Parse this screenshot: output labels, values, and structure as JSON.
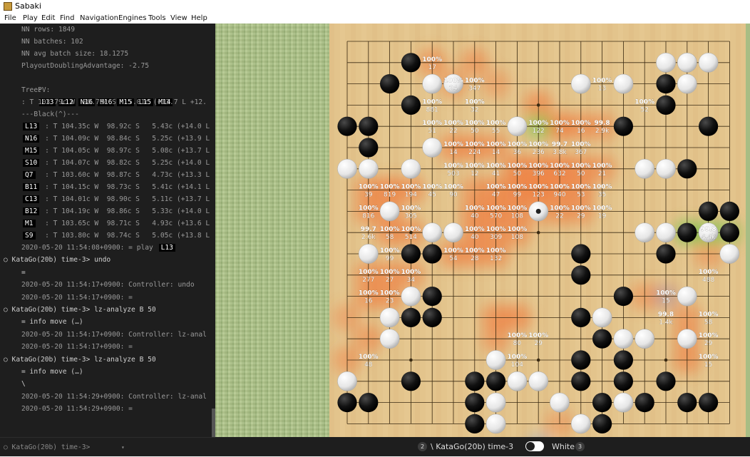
{
  "window": {
    "title": "Sabaki"
  },
  "menu": [
    "File",
    "Play",
    "Edit",
    "Find",
    "Navigation",
    "Engines",
    "Tools",
    "View",
    "Help"
  ],
  "console": {
    "stats": [
      "NN rows: 1849",
      "NN batches: 102",
      "NN avg batch size: 18.1275",
      "PlayoutDoublingAdvantage: -2.75"
    ],
    "pv_label": "PV:",
    "pv_moves": [
      "L13",
      "L12",
      "N16",
      "M16",
      "M15",
      "L15",
      "M14"
    ],
    "tree_label": "Tree:",
    "tree_root": ": T 103.79c W  98.78c S   5.01c (+13.7 L +12.",
    "black_header": "---Black(^)---",
    "tree_rows": [
      {
        "move": "L13",
        "text": " : T 104.35c W  98.92c S   5.43c (+14.0 L"
      },
      {
        "move": "N16",
        "text": " : T 104.09c W  98.84c S   5.25c (+13.9 L"
      },
      {
        "move": "M15",
        "text": " : T 104.05c W  98.97c S   5.08c (+13.7 L"
      },
      {
        "move": "S10",
        "text": " : T 104.07c W  98.82c S   5.25c (+14.0 L"
      },
      {
        "move": "Q7",
        "text": "  : T 103.60c W  98.87c S   4.73c (+13.3 L"
      },
      {
        "move": "B11",
        "text": " : T 104.15c W  98.73c S   5.41c (+14.1 L"
      },
      {
        "move": "C13",
        "text": " : T 104.01c W  98.90c S   5.11c (+13.7 L"
      },
      {
        "move": "B12",
        "text": " : T 104.19c W  98.86c S   5.33c (+14.0 L"
      },
      {
        "move": "M1",
        "text": "  : T 103.65c W  98.71c S   4.93c (+13.6 L"
      },
      {
        "move": "S9",
        "text": "  : T 103.80c W  98.74c S   5.05c (+13.8 L"
      }
    ],
    "log": [
      {
        "kind": "ts",
        "text": "2020-05-20 11:54:08+0900: = play ",
        "move": "L13"
      },
      {
        "kind": "prompt",
        "text": "○ KataGo(20b) time-3> undo"
      },
      {
        "kind": "resp",
        "text": "="
      },
      {
        "kind": "ts",
        "text": "2020-05-20 11:54:17+0900: Controller: undo"
      },
      {
        "kind": "ts",
        "text": "2020-05-20 11:54:17+0900: ="
      },
      {
        "kind": "prompt",
        "text": "○ KataGo(20b) time-3> lz-analyze B 50"
      },
      {
        "kind": "resp",
        "text": "= info move (…)"
      },
      {
        "kind": "ts",
        "text": "2020-05-20 11:54:17+0900: Controller: lz-anal"
      },
      {
        "kind": "ts",
        "text": "2020-05-20 11:54:17+0900: ="
      },
      {
        "kind": "prompt",
        "text": "○ KataGo(20b) time-3> lz-analyze B 50"
      },
      {
        "kind": "resp",
        "text": "= info move (…)"
      },
      {
        "kind": "resp",
        "text": "\\"
      },
      {
        "kind": "ts",
        "text": "2020-05-20 11:54:29+0900: Controller: lz-anal"
      },
      {
        "kind": "ts",
        "text": "2020-05-20 11:54:29+0900: ="
      }
    ]
  },
  "input": {
    "prompt": "○ KataGo(20b) time-3>",
    "caret": "▾"
  },
  "board": {
    "size": 19,
    "black": [
      [
        3,
        1
      ],
      [
        2,
        2
      ],
      [
        3,
        3
      ],
      [
        0,
        4
      ],
      [
        1,
        4
      ],
      [
        1,
        5
      ],
      [
        13,
        4
      ],
      [
        15,
        2
      ],
      [
        15,
        3
      ],
      [
        16,
        1
      ],
      [
        17,
        4
      ],
      [
        16,
        6
      ],
      [
        17,
        8
      ],
      [
        18,
        8
      ],
      [
        18,
        9
      ],
      [
        16,
        9
      ],
      [
        15,
        10
      ],
      [
        11,
        10
      ],
      [
        4,
        10
      ],
      [
        3,
        10
      ],
      [
        11,
        11
      ],
      [
        13,
        12
      ],
      [
        4,
        12
      ],
      [
        3,
        13
      ],
      [
        4,
        13
      ],
      [
        11,
        13
      ],
      [
        12,
        14
      ],
      [
        14,
        14
      ],
      [
        11,
        15
      ],
      [
        13,
        15
      ],
      [
        3,
        16
      ],
      [
        6,
        16
      ],
      [
        7,
        16
      ],
      [
        8,
        16
      ],
      [
        11,
        16
      ],
      [
        13,
        16
      ],
      [
        15,
        16
      ],
      [
        0,
        17
      ],
      [
        1,
        17
      ],
      [
        6,
        17
      ],
      [
        12,
        17
      ],
      [
        14,
        17
      ],
      [
        16,
        17
      ],
      [
        17,
        17
      ],
      [
        6,
        18
      ],
      [
        12,
        18
      ]
    ],
    "white": [
      [
        15,
        1
      ],
      [
        16,
        1
      ],
      [
        17,
        1
      ],
      [
        4,
        2
      ],
      [
        5,
        2
      ],
      [
        11,
        2
      ],
      [
        13,
        2
      ],
      [
        16,
        2
      ],
      [
        8,
        4
      ],
      [
        4,
        5
      ],
      [
        1,
        6
      ],
      [
        0,
        6
      ],
      [
        3,
        6
      ],
      [
        14,
        6
      ],
      [
        15,
        6
      ],
      [
        2,
        8
      ],
      [
        4,
        9
      ],
      [
        5,
        9
      ],
      [
        14,
        9
      ],
      [
        15,
        9
      ],
      [
        17,
        9
      ],
      [
        1,
        10
      ],
      [
        18,
        10
      ],
      [
        3,
        12
      ],
      [
        16,
        12
      ],
      [
        2,
        13
      ],
      [
        12,
        13
      ],
      [
        2,
        14
      ],
      [
        13,
        14
      ],
      [
        14,
        14
      ],
      [
        16,
        14
      ],
      [
        7,
        15
      ],
      [
        0,
        16
      ],
      [
        8,
        16
      ],
      [
        9,
        16
      ],
      [
        7,
        17
      ],
      [
        10,
        17
      ],
      [
        13,
        17
      ],
      [
        7,
        18
      ],
      [
        11,
        18
      ],
      [
        8,
        19
      ],
      [
        11,
        19
      ]
    ],
    "last_move": [
      9,
      8
    ],
    "heat": [
      [
        4,
        1,
        0.55
      ],
      [
        5,
        2,
        0.45
      ],
      [
        6,
        1,
        0.5
      ],
      [
        7,
        2,
        0.4
      ],
      [
        9,
        3,
        0.6
      ],
      [
        10,
        4,
        0.7
      ],
      [
        11,
        4,
        0.55
      ],
      [
        12,
        4,
        0.5
      ],
      [
        5,
        5,
        0.6
      ],
      [
        6,
        5,
        0.6
      ],
      [
        7,
        5,
        0.5
      ],
      [
        8,
        6,
        0.7
      ],
      [
        9,
        6,
        0.7
      ],
      [
        10,
        6,
        0.75
      ],
      [
        11,
        6,
        0.6
      ],
      [
        12,
        6,
        0.5
      ],
      [
        1,
        7,
        0.55
      ],
      [
        2,
        7,
        0.65
      ],
      [
        3,
        7,
        0.55
      ],
      [
        6,
        7,
        0.5
      ],
      [
        7,
        7,
        0.6
      ],
      [
        8,
        7,
        0.7
      ],
      [
        9,
        7,
        0.8
      ],
      [
        10,
        7,
        0.65
      ],
      [
        11,
        7,
        0.6
      ],
      [
        1,
        8,
        0.55
      ],
      [
        2,
        8,
        0.5
      ],
      [
        6,
        8,
        0.6
      ],
      [
        7,
        8,
        0.65
      ],
      [
        8,
        8,
        0.6
      ],
      [
        9,
        8,
        0.4
      ],
      [
        10,
        8,
        0.55
      ],
      [
        11,
        8,
        0.5
      ],
      [
        2,
        9,
        0.6
      ],
      [
        3,
        9,
        0.55
      ],
      [
        6,
        9,
        0.6
      ],
      [
        7,
        9,
        0.55
      ],
      [
        8,
        9,
        0.55
      ],
      [
        5,
        10,
        0.6
      ],
      [
        6,
        10,
        0.6
      ],
      [
        7,
        10,
        0.55
      ],
      [
        1,
        11,
        0.55
      ],
      [
        2,
        11,
        0.55
      ],
      [
        3,
        11,
        0.5
      ],
      [
        1,
        12,
        0.55
      ],
      [
        2,
        12,
        0.55
      ],
      [
        7,
        13,
        0.6
      ],
      [
        8,
        13,
        0.6
      ],
      [
        7,
        14,
        0.5
      ],
      [
        1,
        14,
        0.5
      ],
      [
        14,
        12,
        0.45
      ],
      [
        16,
        13,
        0.5
      ],
      [
        16,
        14,
        0.5
      ],
      [
        16,
        15,
        0.55
      ],
      [
        17,
        10,
        0.45
      ],
      [
        10,
        18,
        0.4
      ],
      [
        0,
        13,
        0.4
      ],
      [
        0,
        15,
        0.45
      ],
      [
        15,
        12,
        0.35
      ]
    ],
    "heat_green": [
      [
        9,
        4,
        0.6
      ],
      [
        16,
        9,
        0.7
      ],
      [
        17,
        9,
        0.7
      ],
      [
        18,
        9,
        0.55
      ]
    ],
    "heat_blue": [
      [
        9,
        19,
        0.4
      ],
      [
        15,
        12,
        0.35
      ]
    ],
    "labels": [
      {
        "c": 4,
        "r": 1,
        "a": "100%",
        "b": "17"
      },
      {
        "c": 5,
        "r": 2,
        "a": "100%",
        "b": "24"
      },
      {
        "c": 6,
        "r": 2,
        "a": "100%",
        "b": "347"
      },
      {
        "c": 12,
        "r": 2,
        "a": "100%",
        "b": "13"
      },
      {
        "c": 4,
        "r": 3,
        "a": "100%",
        "b": "881"
      },
      {
        "c": 6,
        "r": 3,
        "a": "100%",
        "b": "32"
      },
      {
        "c": 14,
        "r": 3,
        "a": "100%",
        "b": "52"
      },
      {
        "c": 4,
        "r": 4,
        "a": "100%",
        "b": "51"
      },
      {
        "c": 5,
        "r": 4,
        "a": "100%",
        "b": "22"
      },
      {
        "c": 6,
        "r": 4,
        "a": "100%",
        "b": "50"
      },
      {
        "c": 7,
        "r": 4,
        "a": "100%",
        "b": "55"
      },
      {
        "c": 9,
        "r": 4,
        "a": "100%",
        "b": "122"
      },
      {
        "c": 10,
        "r": 4,
        "a": "100%",
        "b": "74"
      },
      {
        "c": 11,
        "r": 4,
        "a": "100%",
        "b": "16"
      },
      {
        "c": 12,
        "r": 4,
        "a": "99.8",
        "b": "2.9k"
      },
      {
        "c": 5,
        "r": 5,
        "a": "100%",
        "b": "14"
      },
      {
        "c": 6,
        "r": 5,
        "a": "100%",
        "b": "224"
      },
      {
        "c": 7,
        "r": 5,
        "a": "100%",
        "b": "14"
      },
      {
        "c": 8,
        "r": 5,
        "a": "100%",
        "b": "36"
      },
      {
        "c": 9,
        "r": 5,
        "a": "100%",
        "b": "236"
      },
      {
        "c": 10,
        "r": 5,
        "a": "99.7",
        "b": "3.8k"
      },
      {
        "c": 11,
        "r": 5,
        "a": "100%",
        "b": "367"
      },
      {
        "c": 5,
        "r": 6,
        "a": "100%",
        "b": "503"
      },
      {
        "c": 6,
        "r": 6,
        "a": "100%",
        "b": "12"
      },
      {
        "c": 7,
        "r": 6,
        "a": "100%",
        "b": "41"
      },
      {
        "c": 8,
        "r": 6,
        "a": "100%",
        "b": "50"
      },
      {
        "c": 9,
        "r": 6,
        "a": "100%",
        "b": "396"
      },
      {
        "c": 10,
        "r": 6,
        "a": "100%",
        "b": "632"
      },
      {
        "c": 11,
        "r": 6,
        "a": "100%",
        "b": "50"
      },
      {
        "c": 12,
        "r": 6,
        "a": "100%",
        "b": "21"
      },
      {
        "c": 1,
        "r": 7,
        "a": "100%",
        "b": "39"
      },
      {
        "c": 2,
        "r": 7,
        "a": "100%",
        "b": "819"
      },
      {
        "c": 3,
        "r": 7,
        "a": "100%",
        "b": "194"
      },
      {
        "c": 4,
        "r": 7,
        "a": "100%",
        "b": "45"
      },
      {
        "c": 5,
        "r": 7,
        "a": "100%",
        "b": "90"
      },
      {
        "c": 7,
        "r": 7,
        "a": "100%",
        "b": "47"
      },
      {
        "c": 8,
        "r": 7,
        "a": "100%",
        "b": "99"
      },
      {
        "c": 9,
        "r": 7,
        "a": "100%",
        "b": "123"
      },
      {
        "c": 10,
        "r": 7,
        "a": "100%",
        "b": "940"
      },
      {
        "c": 11,
        "r": 7,
        "a": "100%",
        "b": "53"
      },
      {
        "c": 12,
        "r": 7,
        "a": "100%",
        "b": "35"
      },
      {
        "c": 1,
        "r": 8,
        "a": "100%",
        "b": "816"
      },
      {
        "c": 3,
        "r": 8,
        "a": "100%",
        "b": "305"
      },
      {
        "c": 6,
        "r": 8,
        "a": "100%",
        "b": "40"
      },
      {
        "c": 7,
        "r": 8,
        "a": "100%",
        "b": "570"
      },
      {
        "c": 8,
        "r": 8,
        "a": "100%",
        "b": "108"
      },
      {
        "c": 10,
        "r": 8,
        "a": "100%",
        "b": "22"
      },
      {
        "c": 11,
        "r": 8,
        "a": "100%",
        "b": "29"
      },
      {
        "c": 12,
        "r": 8,
        "a": "100%",
        "b": "19"
      },
      {
        "c": 1,
        "r": 9,
        "a": "99.7",
        "b": "2.6k"
      },
      {
        "c": 2,
        "r": 9,
        "a": "100%",
        "b": "58"
      },
      {
        "c": 3,
        "r": 9,
        "a": "100%",
        "b": "514"
      },
      {
        "c": 6,
        "r": 9,
        "a": "100%",
        "b": "40"
      },
      {
        "c": 7,
        "r": 9,
        "a": "100%",
        "b": "309"
      },
      {
        "c": 8,
        "r": 9,
        "a": "100%",
        "b": "108"
      },
      {
        "c": 17,
        "r": 9,
        "a": "99.8",
        "b": "4.4k"
      },
      {
        "c": 2,
        "r": 10,
        "a": "100%",
        "b": "99"
      },
      {
        "c": 5,
        "r": 10,
        "a": "100%",
        "b": "54"
      },
      {
        "c": 6,
        "r": 10,
        "a": "100%",
        "b": "28"
      },
      {
        "c": 7,
        "r": 10,
        "a": "100%",
        "b": "132"
      },
      {
        "c": 1,
        "r": 11,
        "a": "100%",
        "b": "277"
      },
      {
        "c": 2,
        "r": 11,
        "a": "100%",
        "b": "27"
      },
      {
        "c": 3,
        "r": 11,
        "a": "100%",
        "b": "34"
      },
      {
        "c": 17,
        "r": 11,
        "a": "100%",
        "b": "488"
      },
      {
        "c": 1,
        "r": 12,
        "a": "100%",
        "b": "16"
      },
      {
        "c": 2,
        "r": 12,
        "a": "100%",
        "b": "23"
      },
      {
        "c": 15,
        "r": 12,
        "a": "100%",
        "b": "15"
      },
      {
        "c": 15,
        "r": 13,
        "a": "99.8",
        "b": "1.4k"
      },
      {
        "c": 17,
        "r": 13,
        "a": "100%",
        "b": "58"
      },
      {
        "c": 8,
        "r": 14,
        "a": "100%",
        "b": "80"
      },
      {
        "c": 9,
        "r": 14,
        "a": "100%",
        "b": "29"
      },
      {
        "c": 17,
        "r": 14,
        "a": "100%",
        "b": "29"
      },
      {
        "c": 1,
        "r": 15,
        "a": "100%",
        "b": "48"
      },
      {
        "c": 8,
        "r": 15,
        "a": "100%",
        "b": "104"
      },
      {
        "c": 17,
        "r": 15,
        "a": "100%",
        "b": "15"
      },
      {
        "c": 11,
        "r": 19,
        "a": "99.7",
        "b": "1.9k"
      }
    ]
  },
  "status": {
    "black_captures": "2",
    "black_name": "\\ KataGo(20b) time-3",
    "white_name": "White",
    "white_captures": "3",
    "colors": {
      "heat": "#f07a3c",
      "heat_green": "#7ac24a",
      "heat_blue": "#7d9ddc"
    }
  }
}
